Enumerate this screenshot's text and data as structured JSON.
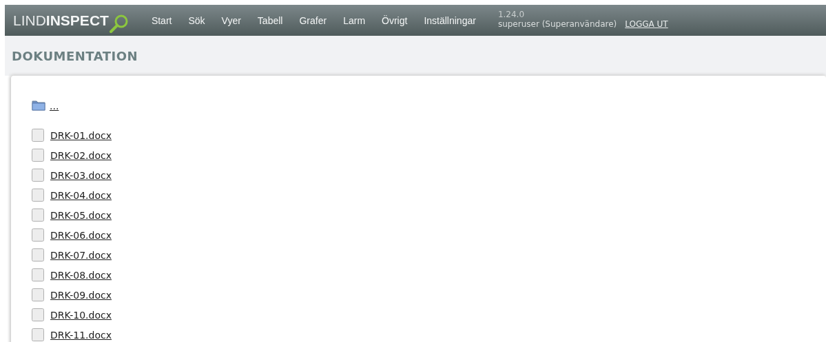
{
  "header": {
    "logo": "LIND**INSPECT**",
    "nav": [
      {
        "label": "Start"
      },
      {
        "label": "Sök"
      },
      {
        "label": "Vyer"
      },
      {
        "label": "Tabell"
      },
      {
        "label": "Grafer"
      },
      {
        "label": "Larm"
      },
      {
        "label": "Övrigt"
      },
      {
        "label": "Inställningar"
      }
    ],
    "version": "1.24.0",
    "user": "superuser (Superanvändare)",
    "logout": "LOGGA UT"
  },
  "page_title": "DOKUMENTATION",
  "files": [
    {
      "kind": "folder",
      "name": "..."
    },
    {
      "kind": "file",
      "name": "DRK-01.docx"
    },
    {
      "kind": "file",
      "name": "DRK-02.docx"
    },
    {
      "kind": "file",
      "name": "DRK-03.docx"
    },
    {
      "kind": "file",
      "name": "DRK-04.docx"
    },
    {
      "kind": "file",
      "name": "DRK-05.docx"
    },
    {
      "kind": "file",
      "name": "DRK-06.docx"
    },
    {
      "kind": "file",
      "name": "DRK-07.docx"
    },
    {
      "kind": "file",
      "name": "DRK-08.docx"
    },
    {
      "kind": "file",
      "name": "DRK-09.docx"
    },
    {
      "kind": "file",
      "name": "DRK-10.docx"
    },
    {
      "kind": "file",
      "name": "DRK-11.docx"
    }
  ]
}
